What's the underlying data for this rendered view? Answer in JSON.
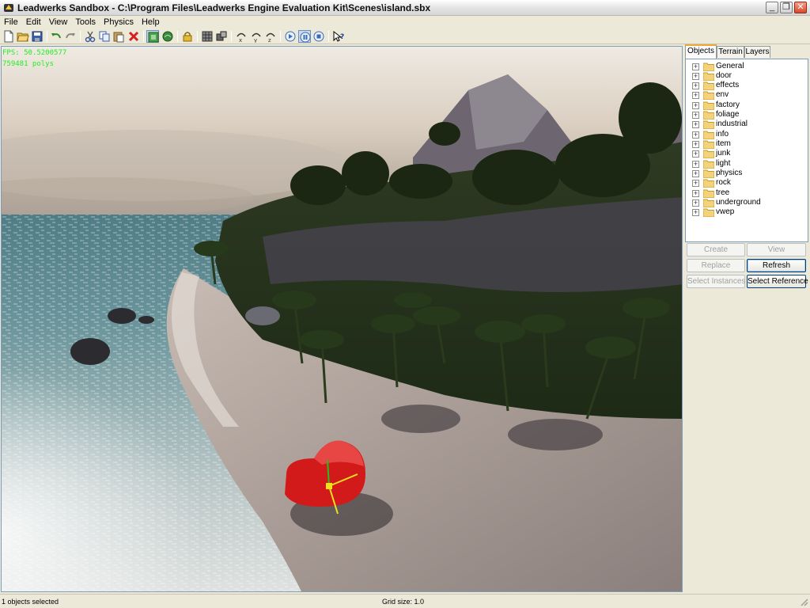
{
  "window": {
    "title": "Leadwerks Sandbox - C:\\Program Files\\Leadwerks Engine Evaluation Kit\\Scenes\\island.sbx",
    "minimize_label": "_",
    "restore_label": "❐",
    "close_label": "✕"
  },
  "menu": {
    "items": [
      {
        "label": "File"
      },
      {
        "label": "Edit"
      },
      {
        "label": "View"
      },
      {
        "label": "Tools"
      },
      {
        "label": "Physics"
      },
      {
        "label": "Help"
      }
    ]
  },
  "toolbar": {
    "icons": [
      "new-file-icon",
      "open-folder-icon",
      "save-icon",
      "undo-icon",
      "redo-icon",
      "cut-icon",
      "copy-icon",
      "paste-icon",
      "delete-icon",
      "select-mode-icon",
      "terrain-mode-icon",
      "lock-icon",
      "grid-icon",
      "snap-icon",
      "rotate-x-icon",
      "rotate-y-icon",
      "rotate-z-icon",
      "play-icon",
      "pause-icon",
      "stop-icon",
      "help-icon"
    ]
  },
  "viewport": {
    "fps_text": "FPS: 50.5200577",
    "polys_text": "759481 polys",
    "fps_color": "#22ee22"
  },
  "panel": {
    "tabs": [
      {
        "label": "Objects",
        "active": true
      },
      {
        "label": "Terrain",
        "active": false
      },
      {
        "label": "Layers",
        "active": false
      }
    ],
    "tree_items": [
      {
        "label": "General"
      },
      {
        "label": "door"
      },
      {
        "label": "effects"
      },
      {
        "label": "env"
      },
      {
        "label": "factory"
      },
      {
        "label": "foliage"
      },
      {
        "label": "industrial"
      },
      {
        "label": "info"
      },
      {
        "label": "item"
      },
      {
        "label": "junk"
      },
      {
        "label": "light"
      },
      {
        "label": "physics"
      },
      {
        "label": "rock"
      },
      {
        "label": "tree"
      },
      {
        "label": "underground"
      },
      {
        "label": "vwep"
      }
    ],
    "expander_symbol": "+",
    "buttons": {
      "create": "Create",
      "view": "View",
      "replace": "Replace",
      "refresh": "Refresh",
      "select_instances": "Select Instances",
      "select_reference": "Select Reference"
    }
  },
  "status": {
    "selection": "1 objects selected",
    "grid": "Grid size: 1.0"
  },
  "colors": {
    "accent_tab": "#f1a835",
    "folder": "#f3d27a",
    "selected_object": "#d31a1a"
  }
}
